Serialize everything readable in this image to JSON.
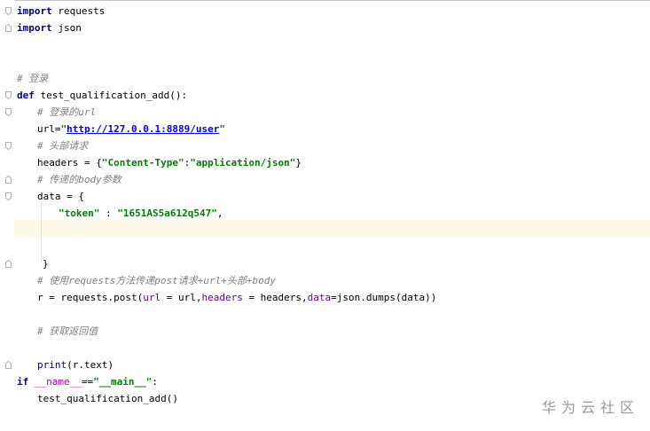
{
  "editor": {
    "lines": [
      {
        "gutter": "fold-start",
        "segments": [
          {
            "cls": "kw",
            "t": "import"
          },
          {
            "cls": "plain",
            "t": " requests"
          }
        ]
      },
      {
        "gutter": "fold-end",
        "segments": [
          {
            "cls": "kw",
            "t": "import"
          },
          {
            "cls": "plain",
            "t": " json"
          }
        ]
      },
      {
        "gutter": "",
        "segments": []
      },
      {
        "gutter": "",
        "segments": []
      },
      {
        "gutter": "",
        "segments": [
          {
            "cls": "cm",
            "t": "# 登录"
          }
        ]
      },
      {
        "gutter": "fold-start",
        "segments": [
          {
            "cls": "kw",
            "t": "def"
          },
          {
            "cls": "plain",
            "t": " test_qualification_add():"
          }
        ]
      },
      {
        "gutter": "fold-start",
        "indent": 1,
        "segments": [
          {
            "cls": "cm",
            "t": "# 登录的url"
          }
        ]
      },
      {
        "gutter": "",
        "indent": 1,
        "segments": [
          {
            "cls": "plain",
            "t": "url="
          },
          {
            "cls": "str",
            "t": "\""
          },
          {
            "cls": "url",
            "t": "http://127.0.0.1:8889/user"
          },
          {
            "cls": "str",
            "t": "\""
          }
        ]
      },
      {
        "gutter": "fold-start",
        "indent": 1,
        "segments": [
          {
            "cls": "cm",
            "t": "# 头部请求"
          }
        ]
      },
      {
        "gutter": "",
        "indent": 1,
        "segments": [
          {
            "cls": "plain",
            "t": "headers = {"
          },
          {
            "cls": "str",
            "t": "\"Content-Type\""
          },
          {
            "cls": "plain",
            "t": ":"
          },
          {
            "cls": "str",
            "t": "\"application/json\""
          },
          {
            "cls": "plain",
            "t": "}"
          }
        ]
      },
      {
        "gutter": "fold-end",
        "indent": 1,
        "segments": [
          {
            "cls": "cm",
            "t": "# 传递的body参数"
          }
        ]
      },
      {
        "gutter": "fold-start",
        "indent": 1,
        "segments": [
          {
            "cls": "plain",
            "t": "data = {"
          }
        ]
      },
      {
        "gutter": "",
        "indent": 2,
        "segments": [
          {
            "cls": "str",
            "t": "\"token\""
          },
          {
            "cls": "plain",
            "t": " : "
          },
          {
            "cls": "str",
            "t": "\"1651AS5a612q547\""
          },
          {
            "cls": "plain",
            "t": ","
          }
        ]
      },
      {
        "gutter": "",
        "segments": []
      },
      {
        "gutter": "",
        "segments": []
      },
      {
        "gutter": "fold-end",
        "indent": 3,
        "segments": [
          {
            "cls": "plain",
            "t": "}"
          }
        ]
      },
      {
        "gutter": "",
        "indent": 1,
        "segments": [
          {
            "cls": "cm",
            "t": "# 使用requests方法传递post请求+url+头部+body"
          }
        ]
      },
      {
        "gutter": "",
        "indent": 1,
        "segments": [
          {
            "cls": "plain",
            "t": "r = requests.post("
          },
          {
            "cls": "kwarg",
            "t": "url"
          },
          {
            "cls": "plain",
            "t": " = url,"
          },
          {
            "cls": "kwarg",
            "t": "headers"
          },
          {
            "cls": "plain",
            "t": " = headers,"
          },
          {
            "cls": "kwarg",
            "t": "data"
          },
          {
            "cls": "plain",
            "t": "=json.dumps(data))"
          }
        ]
      },
      {
        "gutter": "",
        "segments": []
      },
      {
        "gutter": "",
        "indent": 1,
        "segments": [
          {
            "cls": "cm",
            "t": "# 获取返回值"
          }
        ]
      },
      {
        "gutter": "",
        "segments": []
      },
      {
        "gutter": "fold-end",
        "indent": 1,
        "segments": [
          {
            "cls": "builtin",
            "t": "print"
          },
          {
            "cls": "plain",
            "t": "(r.text)"
          }
        ]
      },
      {
        "gutter": "",
        "segments": [
          {
            "cls": "kw",
            "t": "if"
          },
          {
            "cls": "plain",
            "t": " "
          },
          {
            "cls": "dunder",
            "t": "__name__"
          },
          {
            "cls": "plain",
            "t": "=="
          },
          {
            "cls": "str",
            "t": "\"__main__\""
          },
          {
            "cls": "plain",
            "t": ":"
          }
        ]
      },
      {
        "gutter": "",
        "indent": 1,
        "segments": [
          {
            "cls": "plain",
            "t": "test_qualification_add()"
          }
        ]
      }
    ]
  },
  "watermark": {
    "text": "华为云社区"
  }
}
